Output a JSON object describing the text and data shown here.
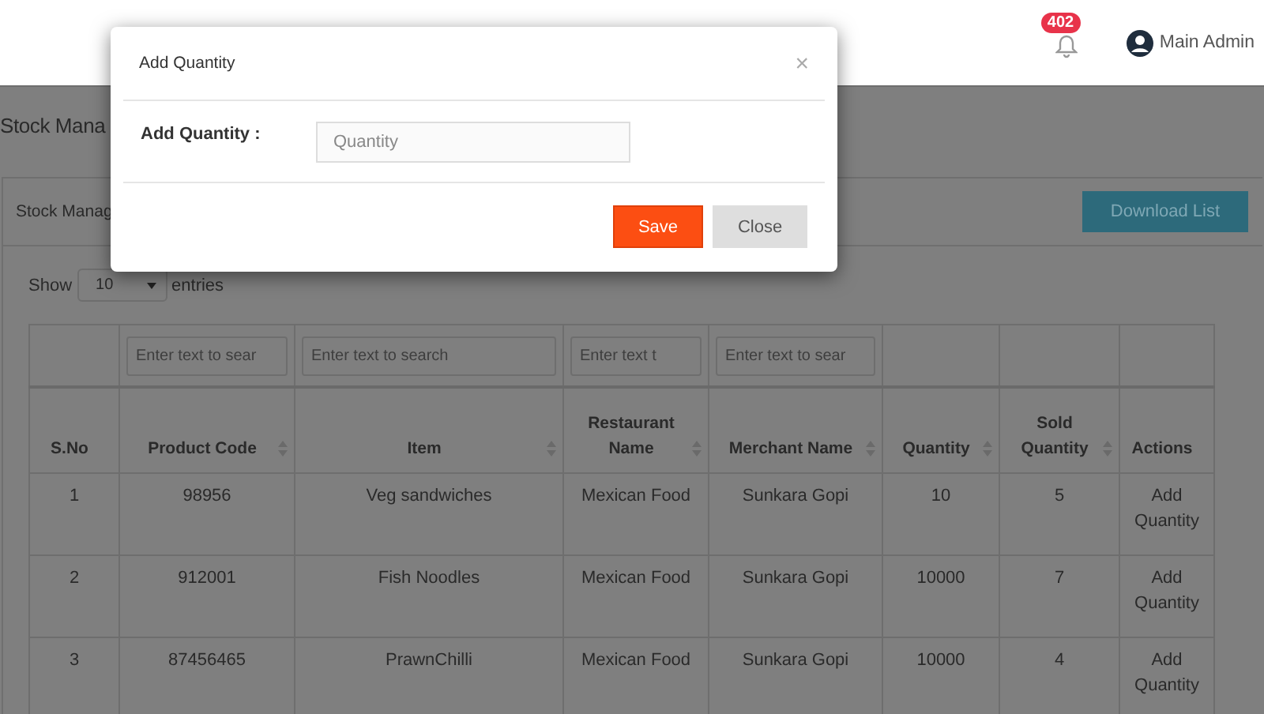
{
  "header": {
    "notification_count": "402",
    "user_name": "Main Admin"
  },
  "page_title": "Stock Mana",
  "card": {
    "title": "Stock Manag",
    "download_button": "Download List"
  },
  "length_menu": {
    "label_before": "Show",
    "value": "10",
    "label_after": "entries"
  },
  "table": {
    "columns": [
      {
        "label": "S.No",
        "sortable": false
      },
      {
        "label": "Product Code",
        "sortable": true,
        "filter_placeholder": "Enter text to sear"
      },
      {
        "label": "Item",
        "sortable": true,
        "filter_placeholder": "Enter text to search"
      },
      {
        "label": "Restaurant Name",
        "sortable": true,
        "filter_placeholder": "Enter text t"
      },
      {
        "label": "Merchant Name",
        "sortable": true,
        "filter_placeholder": "Enter text to sear"
      },
      {
        "label": "Quantity",
        "sortable": true
      },
      {
        "label": "Sold Quantity",
        "sortable": true
      },
      {
        "label": "Actions",
        "sortable": false
      }
    ],
    "rows": [
      [
        "1",
        "98956",
        "Veg sandwiches",
        "Mexican Food",
        "Sunkara Gopi",
        "10",
        "5",
        "Add Quantity"
      ],
      [
        "2",
        "912001",
        "Fish Noodles",
        "Mexican Food",
        "Sunkara Gopi",
        "10000",
        "7",
        "Add Quantity"
      ],
      [
        "3",
        "87456465",
        "PrawnChilli",
        "Mexican Food",
        "Sunkara Gopi",
        "10000",
        "4",
        "Add Quantity"
      ]
    ]
  },
  "modal": {
    "title": "Add Quantity",
    "close_symbol": "×",
    "field_label": "Add Quantity :",
    "field_placeholder": "Quantity",
    "buttons": [
      {
        "label": "Save",
        "kind": "primary"
      },
      {
        "label": "Close",
        "kind": "secondary"
      }
    ]
  }
}
